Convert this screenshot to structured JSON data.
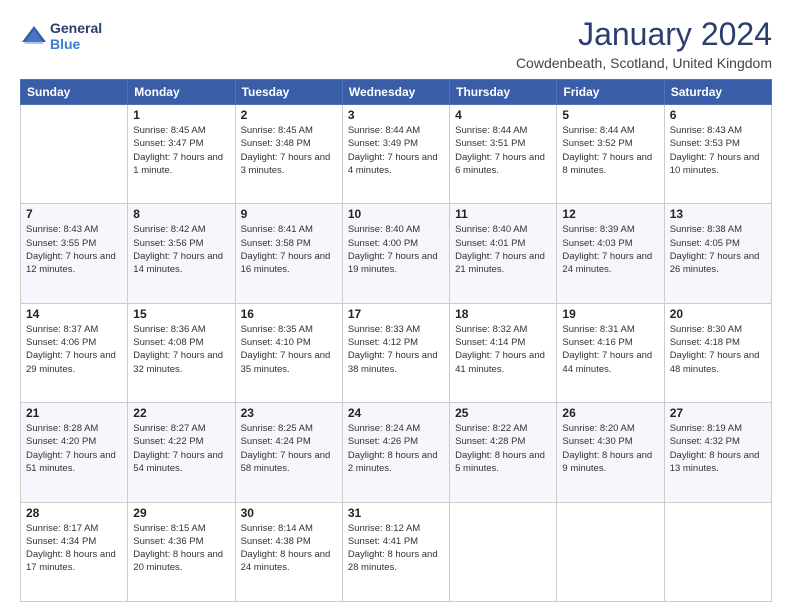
{
  "header": {
    "logo_line1": "General",
    "logo_line2": "Blue",
    "title": "January 2024",
    "subtitle": "Cowdenbeath, Scotland, United Kingdom"
  },
  "days_of_week": [
    "Sunday",
    "Monday",
    "Tuesday",
    "Wednesday",
    "Thursday",
    "Friday",
    "Saturday"
  ],
  "weeks": [
    [
      {
        "day": "",
        "sunrise": "",
        "sunset": "",
        "daylight": ""
      },
      {
        "day": "1",
        "sunrise": "Sunrise: 8:45 AM",
        "sunset": "Sunset: 3:47 PM",
        "daylight": "Daylight: 7 hours and 1 minute."
      },
      {
        "day": "2",
        "sunrise": "Sunrise: 8:45 AM",
        "sunset": "Sunset: 3:48 PM",
        "daylight": "Daylight: 7 hours and 3 minutes."
      },
      {
        "day": "3",
        "sunrise": "Sunrise: 8:44 AM",
        "sunset": "Sunset: 3:49 PM",
        "daylight": "Daylight: 7 hours and 4 minutes."
      },
      {
        "day": "4",
        "sunrise": "Sunrise: 8:44 AM",
        "sunset": "Sunset: 3:51 PM",
        "daylight": "Daylight: 7 hours and 6 minutes."
      },
      {
        "day": "5",
        "sunrise": "Sunrise: 8:44 AM",
        "sunset": "Sunset: 3:52 PM",
        "daylight": "Daylight: 7 hours and 8 minutes."
      },
      {
        "day": "6",
        "sunrise": "Sunrise: 8:43 AM",
        "sunset": "Sunset: 3:53 PM",
        "daylight": "Daylight: 7 hours and 10 minutes."
      }
    ],
    [
      {
        "day": "7",
        "sunrise": "Sunrise: 8:43 AM",
        "sunset": "Sunset: 3:55 PM",
        "daylight": "Daylight: 7 hours and 12 minutes."
      },
      {
        "day": "8",
        "sunrise": "Sunrise: 8:42 AM",
        "sunset": "Sunset: 3:56 PM",
        "daylight": "Daylight: 7 hours and 14 minutes."
      },
      {
        "day": "9",
        "sunrise": "Sunrise: 8:41 AM",
        "sunset": "Sunset: 3:58 PM",
        "daylight": "Daylight: 7 hours and 16 minutes."
      },
      {
        "day": "10",
        "sunrise": "Sunrise: 8:40 AM",
        "sunset": "Sunset: 4:00 PM",
        "daylight": "Daylight: 7 hours and 19 minutes."
      },
      {
        "day": "11",
        "sunrise": "Sunrise: 8:40 AM",
        "sunset": "Sunset: 4:01 PM",
        "daylight": "Daylight: 7 hours and 21 minutes."
      },
      {
        "day": "12",
        "sunrise": "Sunrise: 8:39 AM",
        "sunset": "Sunset: 4:03 PM",
        "daylight": "Daylight: 7 hours and 24 minutes."
      },
      {
        "day": "13",
        "sunrise": "Sunrise: 8:38 AM",
        "sunset": "Sunset: 4:05 PM",
        "daylight": "Daylight: 7 hours and 26 minutes."
      }
    ],
    [
      {
        "day": "14",
        "sunrise": "Sunrise: 8:37 AM",
        "sunset": "Sunset: 4:06 PM",
        "daylight": "Daylight: 7 hours and 29 minutes."
      },
      {
        "day": "15",
        "sunrise": "Sunrise: 8:36 AM",
        "sunset": "Sunset: 4:08 PM",
        "daylight": "Daylight: 7 hours and 32 minutes."
      },
      {
        "day": "16",
        "sunrise": "Sunrise: 8:35 AM",
        "sunset": "Sunset: 4:10 PM",
        "daylight": "Daylight: 7 hours and 35 minutes."
      },
      {
        "day": "17",
        "sunrise": "Sunrise: 8:33 AM",
        "sunset": "Sunset: 4:12 PM",
        "daylight": "Daylight: 7 hours and 38 minutes."
      },
      {
        "day": "18",
        "sunrise": "Sunrise: 8:32 AM",
        "sunset": "Sunset: 4:14 PM",
        "daylight": "Daylight: 7 hours and 41 minutes."
      },
      {
        "day": "19",
        "sunrise": "Sunrise: 8:31 AM",
        "sunset": "Sunset: 4:16 PM",
        "daylight": "Daylight: 7 hours and 44 minutes."
      },
      {
        "day": "20",
        "sunrise": "Sunrise: 8:30 AM",
        "sunset": "Sunset: 4:18 PM",
        "daylight": "Daylight: 7 hours and 48 minutes."
      }
    ],
    [
      {
        "day": "21",
        "sunrise": "Sunrise: 8:28 AM",
        "sunset": "Sunset: 4:20 PM",
        "daylight": "Daylight: 7 hours and 51 minutes."
      },
      {
        "day": "22",
        "sunrise": "Sunrise: 8:27 AM",
        "sunset": "Sunset: 4:22 PM",
        "daylight": "Daylight: 7 hours and 54 minutes."
      },
      {
        "day": "23",
        "sunrise": "Sunrise: 8:25 AM",
        "sunset": "Sunset: 4:24 PM",
        "daylight": "Daylight: 7 hours and 58 minutes."
      },
      {
        "day": "24",
        "sunrise": "Sunrise: 8:24 AM",
        "sunset": "Sunset: 4:26 PM",
        "daylight": "Daylight: 8 hours and 2 minutes."
      },
      {
        "day": "25",
        "sunrise": "Sunrise: 8:22 AM",
        "sunset": "Sunset: 4:28 PM",
        "daylight": "Daylight: 8 hours and 5 minutes."
      },
      {
        "day": "26",
        "sunrise": "Sunrise: 8:20 AM",
        "sunset": "Sunset: 4:30 PM",
        "daylight": "Daylight: 8 hours and 9 minutes."
      },
      {
        "day": "27",
        "sunrise": "Sunrise: 8:19 AM",
        "sunset": "Sunset: 4:32 PM",
        "daylight": "Daylight: 8 hours and 13 minutes."
      }
    ],
    [
      {
        "day": "28",
        "sunrise": "Sunrise: 8:17 AM",
        "sunset": "Sunset: 4:34 PM",
        "daylight": "Daylight: 8 hours and 17 minutes."
      },
      {
        "day": "29",
        "sunrise": "Sunrise: 8:15 AM",
        "sunset": "Sunset: 4:36 PM",
        "daylight": "Daylight: 8 hours and 20 minutes."
      },
      {
        "day": "30",
        "sunrise": "Sunrise: 8:14 AM",
        "sunset": "Sunset: 4:38 PM",
        "daylight": "Daylight: 8 hours and 24 minutes."
      },
      {
        "day": "31",
        "sunrise": "Sunrise: 8:12 AM",
        "sunset": "Sunset: 4:41 PM",
        "daylight": "Daylight: 8 hours and 28 minutes."
      },
      {
        "day": "",
        "sunrise": "",
        "sunset": "",
        "daylight": ""
      },
      {
        "day": "",
        "sunrise": "",
        "sunset": "",
        "daylight": ""
      },
      {
        "day": "",
        "sunrise": "",
        "sunset": "",
        "daylight": ""
      }
    ]
  ]
}
